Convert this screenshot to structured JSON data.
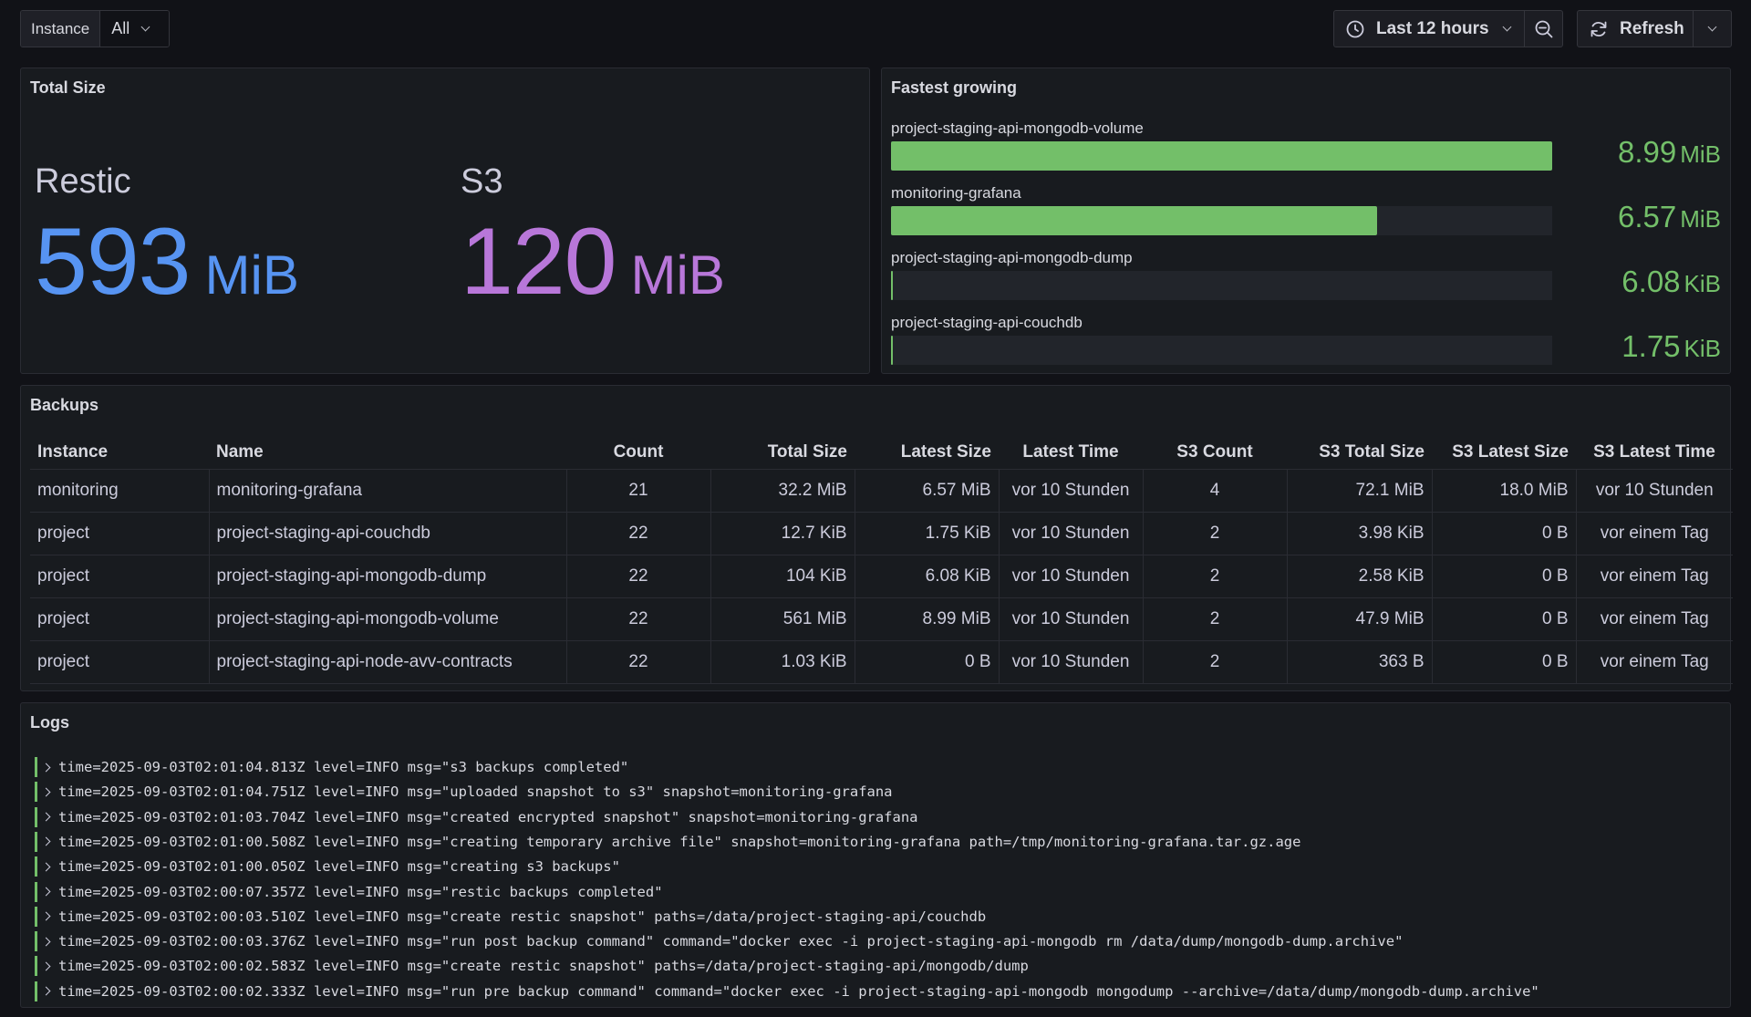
{
  "toolbar": {
    "instance_label": "Instance",
    "instance_value": "All",
    "time_range": "Last 12 hours",
    "refresh_label": "Refresh"
  },
  "total_size": {
    "title": "Total Size",
    "restic": {
      "label": "Restic",
      "value": "593",
      "unit": "MiB",
      "color": "#5794f2"
    },
    "s3": {
      "label": "S3",
      "value": "120",
      "unit": "MiB",
      "color": "#b877d9"
    }
  },
  "fastest_growing": {
    "title": "Fastest growing",
    "color": "#73bf69",
    "items": [
      {
        "name": "project-staging-api-mongodb-volume",
        "value": "8.99",
        "unit": "MiB",
        "fill": 1.0
      },
      {
        "name": "monitoring-grafana",
        "value": "6.57",
        "unit": "MiB",
        "fill": 0.735
      },
      {
        "name": "project-staging-api-mongodb-dump",
        "value": "6.08",
        "unit": "KiB",
        "fill": 0.003
      },
      {
        "name": "project-staging-api-couchdb",
        "value": "1.75",
        "unit": "KiB",
        "fill": 0.003
      }
    ]
  },
  "backups": {
    "title": "Backups",
    "columns": [
      "Instance",
      "Name",
      "Count",
      "Total Size",
      "Latest Size",
      "Latest Time",
      "S3 Count",
      "S3 Total Size",
      "S3 Latest Size",
      "S3 Latest Time"
    ],
    "rows": [
      [
        "monitoring",
        "monitoring-grafana",
        "21",
        "32.2 MiB",
        "6.57 MiB",
        "vor 10 Stunden",
        "4",
        "72.1 MiB",
        "18.0 MiB",
        "vor 10 Stunden"
      ],
      [
        "project",
        "project-staging-api-couchdb",
        "22",
        "12.7 KiB",
        "1.75 KiB",
        "vor 10 Stunden",
        "2",
        "3.98 KiB",
        "0 B",
        "vor einem Tag"
      ],
      [
        "project",
        "project-staging-api-mongodb-dump",
        "22",
        "104 KiB",
        "6.08 KiB",
        "vor 10 Stunden",
        "2",
        "2.58 KiB",
        "0 B",
        "vor einem Tag"
      ],
      [
        "project",
        "project-staging-api-mongodb-volume",
        "22",
        "561 MiB",
        "8.99 MiB",
        "vor 10 Stunden",
        "2",
        "47.9 MiB",
        "0 B",
        "vor einem Tag"
      ],
      [
        "project",
        "project-staging-api-node-avv-contracts",
        "22",
        "1.03 KiB",
        "0 B",
        "vor 10 Stunden",
        "2",
        "363 B",
        "0 B",
        "vor einem Tag"
      ]
    ]
  },
  "logs": {
    "title": "Logs",
    "lines": [
      "time=2025-09-03T02:01:04.813Z level=INFO msg=\"s3 backups completed\"",
      "time=2025-09-03T02:01:04.751Z level=INFO msg=\"uploaded snapshot to s3\" snapshot=monitoring-grafana",
      "time=2025-09-03T02:01:03.704Z level=INFO msg=\"created encrypted snapshot\" snapshot=monitoring-grafana",
      "time=2025-09-03T02:01:00.508Z level=INFO msg=\"creating temporary archive file\" snapshot=monitoring-grafana path=/tmp/monitoring-grafana.tar.gz.age",
      "time=2025-09-03T02:01:00.050Z level=INFO msg=\"creating s3 backups\"",
      "time=2025-09-03T02:00:07.357Z level=INFO msg=\"restic backups completed\"",
      "time=2025-09-03T02:00:03.510Z level=INFO msg=\"create restic snapshot\" paths=/data/project-staging-api/couchdb",
      "time=2025-09-03T02:00:03.376Z level=INFO msg=\"run post backup command\" command=\"docker exec -i project-staging-api-mongodb rm /data/dump/mongodb-dump.archive\"",
      "time=2025-09-03T02:00:02.583Z level=INFO msg=\"create restic snapshot\" paths=/data/project-staging-api/mongodb/dump",
      "time=2025-09-03T02:00:02.333Z level=INFO msg=\"run pre backup command\" command=\"docker exec -i project-staging-api-mongodb mongodump --archive=/data/dump/mongodb-dump.archive\""
    ]
  }
}
